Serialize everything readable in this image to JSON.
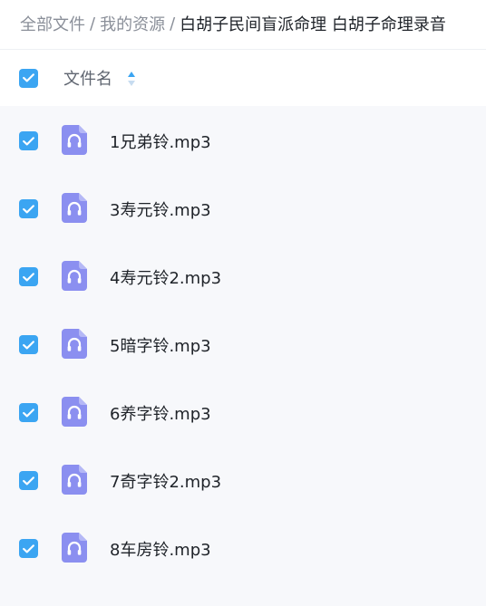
{
  "breadcrumb": {
    "items": [
      "全部文件",
      "我的资源"
    ],
    "separator": "/",
    "current": "白胡子民间盲派命理 白胡子命理录音"
  },
  "header": {
    "column_label": "文件名",
    "select_all_checked": true
  },
  "files": [
    {
      "name": "1兄弟铃.mp3",
      "checked": true,
      "icon": "audio-file-icon"
    },
    {
      "name": "3寿元铃.mp3",
      "checked": true,
      "icon": "audio-file-icon"
    },
    {
      "name": "4寿元铃2.mp3",
      "checked": true,
      "icon": "audio-file-icon"
    },
    {
      "name": "5暗字铃.mp3",
      "checked": true,
      "icon": "audio-file-icon"
    },
    {
      "name": "6养字铃.mp3",
      "checked": true,
      "icon": "audio-file-icon"
    },
    {
      "name": "7奇字铃2.mp3",
      "checked": true,
      "icon": "audio-file-icon"
    },
    {
      "name": "8车房铃.mp3",
      "checked": true,
      "icon": "audio-file-icon"
    }
  ],
  "colors": {
    "accent": "#3ba5f2",
    "file_icon": "#8b8ff0",
    "list_bg": "#f7f8fb"
  }
}
